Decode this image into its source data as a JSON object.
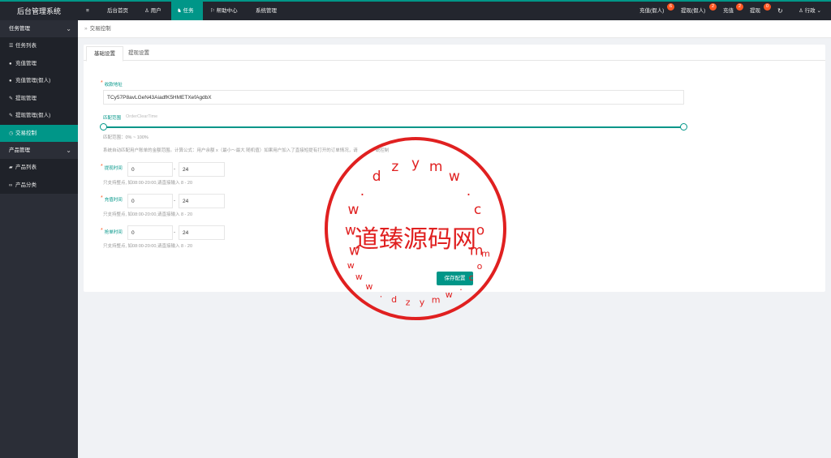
{
  "app": {
    "title": "后台管理系统"
  },
  "sidebar": {
    "groups": [
      {
        "label": "任务管理",
        "items": [
          {
            "icon": "list-icon",
            "glyph": "☰",
            "label": "任务列表"
          },
          {
            "icon": "chat-icon",
            "glyph": "●",
            "label": "充值管理"
          },
          {
            "icon": "chat-icon",
            "glyph": "●",
            "label": "充值管理(假人)"
          },
          {
            "icon": "gavel-icon",
            "glyph": "✎",
            "label": "提现管理"
          },
          {
            "icon": "gavel-icon",
            "glyph": "✎",
            "label": "提现管理(假人)"
          },
          {
            "icon": "clock-icon",
            "glyph": "◷",
            "label": "交易控制"
          }
        ]
      },
      {
        "label": "产品管理",
        "items": [
          {
            "icon": "cart-icon",
            "glyph": "▰",
            "label": "产品列表"
          },
          {
            "icon": "link-icon",
            "glyph": "∞",
            "label": "产品分类"
          }
        ]
      }
    ]
  },
  "topbar": {
    "menu_glyph": "≡",
    "nav": [
      {
        "label": "后台首页",
        "glyph": ""
      },
      {
        "label": "用户",
        "glyph": "♙"
      },
      {
        "label": "任务",
        "glyph": "♞"
      },
      {
        "label": "帮助中心",
        "glyph": "⚐"
      },
      {
        "label": "系统管理",
        "glyph": ""
      }
    ],
    "right": [
      {
        "label": "充值(假人)",
        "badge": "6"
      },
      {
        "label": "提现(假人)",
        "badge": "2"
      },
      {
        "label": "充值",
        "badge": "2"
      },
      {
        "label": "提现",
        "badge": "0"
      }
    ],
    "refresh_glyph": "↻",
    "user": {
      "glyph": "♙",
      "label": "行政",
      "chev": "⌄"
    }
  },
  "breadcrumb": {
    "sep": "»",
    "current": "交易控制"
  },
  "tabs": [
    "基础设置",
    "提现设置"
  ],
  "form": {
    "address_label": "收款地址",
    "address_value": "TCy57P8avLGeN43AiadfK5HMETXefAgdbX",
    "range_label": "匹配范围",
    "range_placeholder": "OrderClearTime",
    "range_hint": "匹配范围：0% ~ 100%",
    "range_desc": "系统自动匹配用户账单的金额范围。计算公式：用户余额 x（最小～最大 随机值）如果用户加入了直接短提有打开的订单情况，请",
    "range_desc_tail": "统控制",
    "withdraw_label": "提现时间",
    "withdraw_from": "0",
    "withdraw_to": "24",
    "withdraw_hint": "只支持整点, 如08:00-20:00,请直接输入 8 - 20",
    "recharge_label": "充值时间",
    "recharge_from": "0",
    "recharge_to": "24",
    "recharge_hint": "只支持整点, 如08:00-20:00,请直接输入 8 - 20",
    "order_label": "抢单时间",
    "order_from": "0",
    "order_to": "24",
    "order_hint": "只支持整点, 如08:00-20:00,请直接输入 8 - 20",
    "dash": "-",
    "save_label": "保存配置"
  },
  "watermark": {
    "center_text": "道臻源码网",
    "ring_top": [
      "w",
      "w",
      "w",
      ".",
      "d",
      "z",
      "y",
      "m",
      "w",
      ".",
      "c",
      "o",
      "m"
    ],
    "ring_bottom": [
      "w",
      "w",
      "w",
      ".",
      "d",
      "z",
      "y",
      "m",
      "w",
      ".",
      "c",
      "o",
      "m"
    ]
  }
}
